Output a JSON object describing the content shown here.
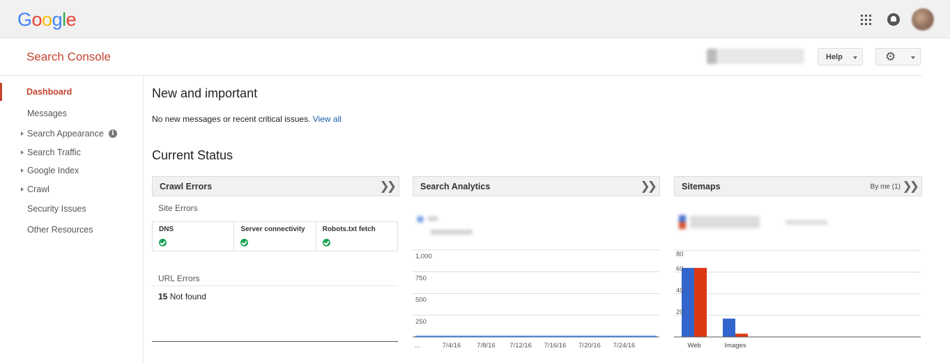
{
  "topbar": {
    "logo": [
      "G",
      "o",
      "o",
      "g",
      "l",
      "e"
    ],
    "logo_colors": [
      "#4285f4",
      "#ea4335",
      "#fbbc05",
      "#4285f4",
      "#34a853",
      "#ea4335"
    ],
    "icons": [
      "apps-grid-icon",
      "notifications-bell-icon",
      "account-avatar"
    ]
  },
  "header": {
    "title": "Search Console",
    "help_label": "Help",
    "settings_icon": "gear-icon"
  },
  "sidebar": {
    "items": [
      {
        "label": "Dashboard",
        "active": true,
        "expandable": false
      },
      {
        "label": "Messages",
        "active": false,
        "expandable": false
      },
      {
        "label": "Search Appearance",
        "active": false,
        "expandable": true,
        "info": true
      },
      {
        "label": "Search Traffic",
        "active": false,
        "expandable": true
      },
      {
        "label": "Google Index",
        "active": false,
        "expandable": true
      },
      {
        "label": "Crawl",
        "active": false,
        "expandable": true
      },
      {
        "label": "Security Issues",
        "active": false,
        "expandable": false
      },
      {
        "label": "Other Resources",
        "active": false,
        "expandable": false
      }
    ]
  },
  "main": {
    "new_important_title": "New and important",
    "notice_text": "No new messages or recent critical issues.",
    "notice_link": "View all",
    "current_status_title": "Current Status"
  },
  "crawl_errors": {
    "title": "Crawl Errors",
    "site_errors_label": "Site Errors",
    "site_errors": [
      {
        "label": "DNS",
        "status": "ok"
      },
      {
        "label": "Server connectivity",
        "status": "ok"
      },
      {
        "label": "Robots.txt fetch",
        "status": "ok"
      }
    ],
    "url_errors_label": "URL Errors",
    "url_errors_count": "15",
    "url_errors_type": "Not found"
  },
  "search_analytics": {
    "title": "Search Analytics"
  },
  "sitemaps": {
    "title": "Sitemaps",
    "filter_label": "By me (1)"
  },
  "chart_data": [
    {
      "type": "line",
      "title": "",
      "y_ticks": [
        "1,000",
        "750",
        "500",
        "250"
      ],
      "x_ticks": [
        "...",
        "7/4/16",
        "7/8/16",
        "7/12/16",
        "7/16/16",
        "7/20/16",
        "7/24/16"
      ],
      "ylim": [
        0,
        1000
      ],
      "series": [
        {
          "values": [
            0,
            0,
            0,
            0,
            0,
            0,
            0,
            0,
            0,
            0,
            0,
            0,
            0,
            0,
            0,
            0,
            0,
            0,
            0,
            0,
            0,
            0,
            0,
            0,
            0,
            0,
            0,
            0
          ],
          "color": "#4285f4"
        }
      ],
      "grid": true
    },
    {
      "type": "bar",
      "title": "",
      "categories": [
        "Web",
        "Images"
      ],
      "y_ticks": [
        "80",
        "60",
        "40",
        "20"
      ],
      "ylim": [
        0,
        80
      ],
      "series": [
        {
          "values": [
            64,
            17
          ],
          "color": "#3366cc"
        },
        {
          "values": [
            64,
            3
          ],
          "color": "#dc3912"
        }
      ],
      "grid": true
    }
  ]
}
